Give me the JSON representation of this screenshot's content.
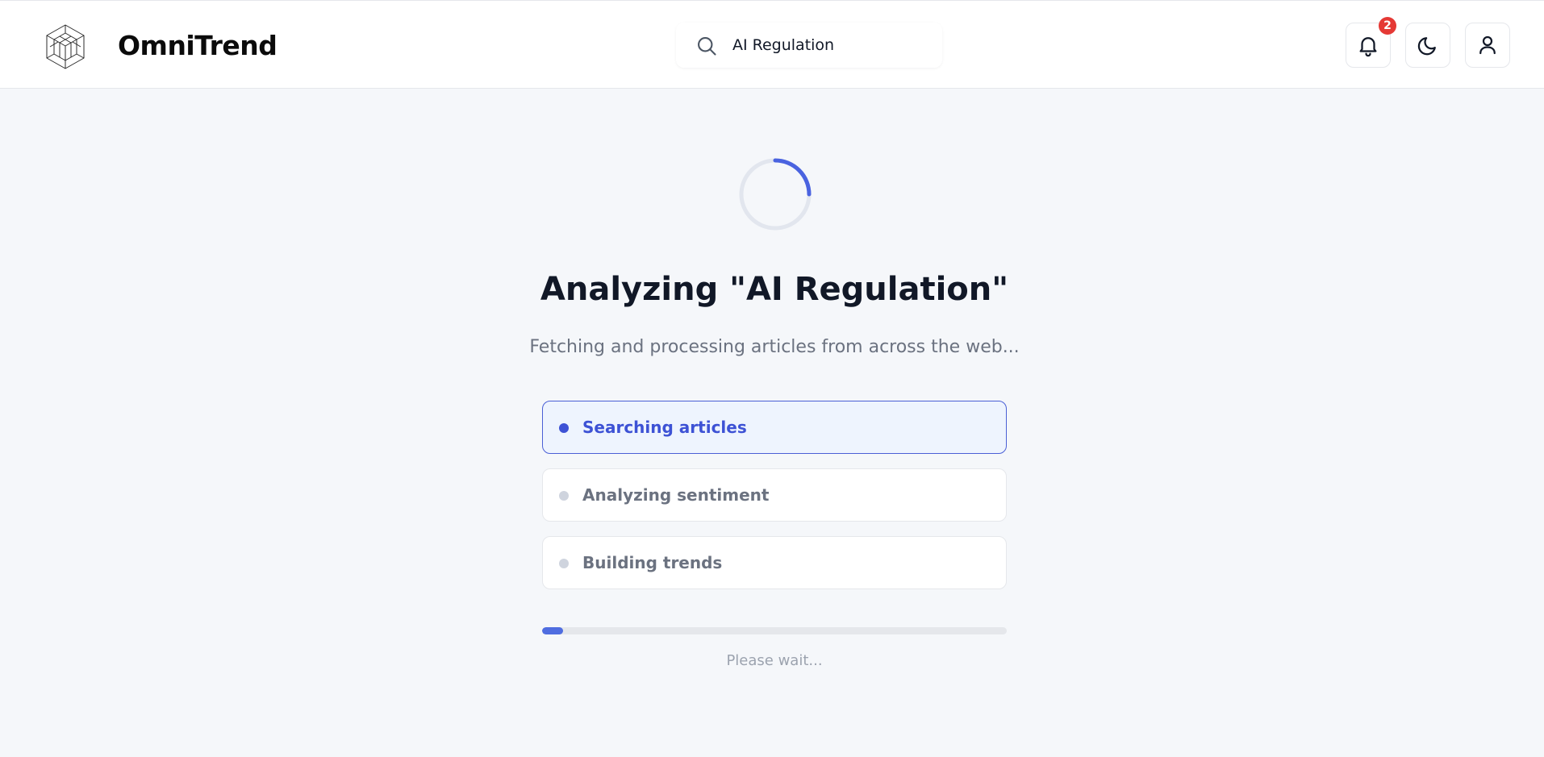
{
  "header": {
    "brand": "OmniTrend",
    "search": {
      "value": "AI Regulation"
    },
    "notifications": {
      "count": "2"
    }
  },
  "main": {
    "title": "Analyzing \"AI Regulation\"",
    "subtitle": "Fetching and processing articles from across the web...",
    "steps": [
      {
        "label": "Searching articles",
        "state": "active"
      },
      {
        "label": "Analyzing sentiment",
        "state": "pending"
      },
      {
        "label": "Building trends",
        "state": "pending"
      }
    ],
    "progress_fraction": 0.045,
    "status": "Please wait..."
  },
  "icons": {
    "logo": "isometric-cube-logo-icon",
    "search": "search-icon",
    "notifications": "bell-icon",
    "theme": "moon-icon",
    "user": "user-icon",
    "spinner": "loading-spinner-icon"
  },
  "colors": {
    "accent": "#3d52d5",
    "progress": "#4f6de0",
    "badge": "#e53935",
    "active_step_bg": "#eef4fe"
  }
}
